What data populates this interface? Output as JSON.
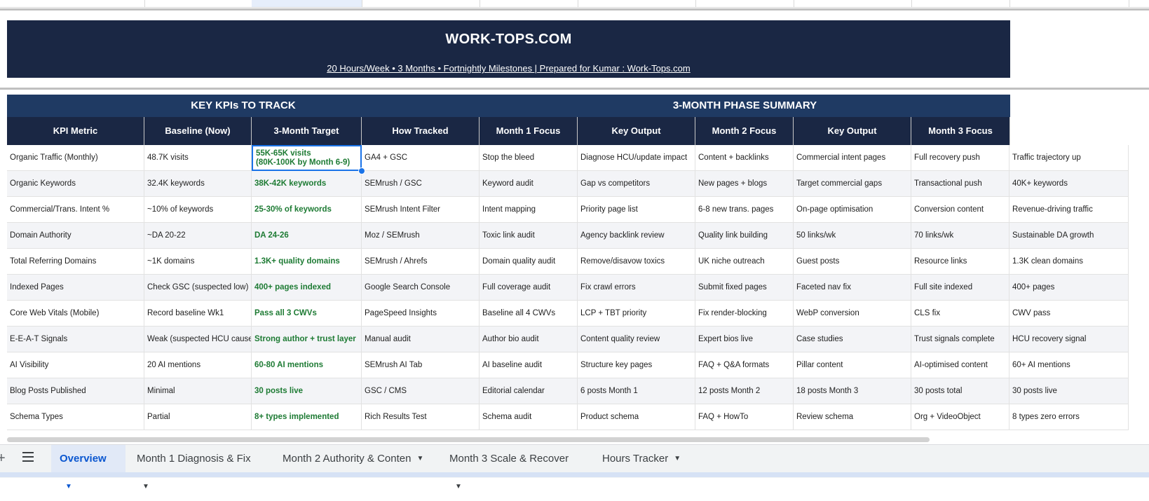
{
  "banner": {
    "title": "WORK-TOPS.COM",
    "subtitle": "20 Hours/Week  •  3 Months  •  Fortnightly Milestones  |  Prepared for Kumar : Work-Tops.com"
  },
  "sections": {
    "kpis": "KEY KPIs TO TRACK",
    "phase": "3-MONTH PHASE SUMMARY"
  },
  "headers": [
    "KPI Metric",
    "Baseline (Now)",
    "3-Month Target",
    "How Tracked",
    "Month 1 Focus",
    "Key Output",
    "Month 2 Focus",
    "Key Output",
    "Month 3 Focus"
  ],
  "rows": [
    {
      "cells": [
        "Organic Traffic (Monthly)",
        "48.7K visits",
        "55K-65K visits\n(80K-100K by Month 6-9)",
        "GA4 + GSC",
        "Stop the bleed",
        "Diagnose HCU/update impact",
        "Content + backlinks",
        "Commercial intent pages",
        "Full recovery push",
        "Traffic trajectory up"
      ]
    },
    {
      "cells": [
        "Organic Keywords",
        "32.4K keywords",
        "38K-42K keywords",
        "SEMrush / GSC",
        "Keyword audit",
        "Gap vs competitors",
        "New pages + blogs",
        "Target commercial gaps",
        "Transactional push",
        "40K+ keywords"
      ]
    },
    {
      "cells": [
        "Commercial/Trans. Intent %",
        "~10% of keywords",
        "25-30% of keywords",
        "SEMrush Intent Filter",
        "Intent mapping",
        "Priority page list",
        "6-8 new trans. pages",
        "On-page optimisation",
        "Conversion content",
        "Revenue-driving traffic"
      ]
    },
    {
      "cells": [
        "Domain Authority",
        "~DA 20-22",
        "DA 24-26",
        "Moz / SEMrush",
        "Toxic link audit",
        "Agency backlink review",
        "Quality link building",
        "50 links/wk",
        "70 links/wk",
        "Sustainable DA growth"
      ]
    },
    {
      "cells": [
        "Total Referring Domains",
        "~1K domains",
        "1.3K+ quality domains",
        "SEMrush / Ahrefs",
        "Domain quality audit",
        "Remove/disavow toxics",
        "UK niche outreach",
        "Guest posts",
        "Resource links",
        "1.3K clean domains"
      ]
    },
    {
      "cells": [
        "Indexed Pages",
        "Check GSC (suspected low)",
        "400+ pages indexed",
        "Google Search Console",
        "Full coverage audit",
        "Fix crawl errors",
        "Submit fixed pages",
        "Faceted nav fix",
        "Full site indexed",
        "400+ pages"
      ]
    },
    {
      "cells": [
        "Core Web Vitals (Mobile)",
        "Record baseline Wk1",
        "Pass all 3 CWVs",
        "PageSpeed Insights",
        "Baseline all 4 CWVs",
        "LCP + TBT priority",
        "Fix render-blocking",
        "WebP conversion",
        "CLS fix",
        "CWV pass"
      ]
    },
    {
      "cells": [
        "E-E-A-T Signals",
        "Weak (suspected HCU cause)",
        "Strong author + trust layer",
        "Manual audit",
        "Author bio audit",
        "Content quality review",
        "Expert bios live",
        "Case studies",
        "Trust signals complete",
        "HCU recovery signal"
      ]
    },
    {
      "cells": [
        "AI Visibility",
        "20 AI mentions",
        "60-80 AI mentions",
        "SEMrush AI Tab",
        "AI baseline audit",
        "Structure key pages",
        "FAQ + Q&A formats",
        "Pillar content",
        "AI-optimised content",
        "60+ AI mentions"
      ]
    },
    {
      "cells": [
        "Blog Posts Published",
        "Minimal",
        "30 posts live",
        "GSC / CMS",
        "Editorial calendar",
        "6 posts Month 1",
        "12 posts Month 2",
        "18 posts Month 3",
        "30 posts total",
        "30 posts live"
      ]
    },
    {
      "cells": [
        "Schema Types",
        "Partial",
        "8+ types implemented",
        "Rich Results Test",
        "Schema audit",
        "Product schema",
        "FAQ + HowTo",
        "Review schema",
        "Org + VideoObject",
        "8 types zero errors"
      ]
    }
  ],
  "tabs": [
    {
      "label": "Overview",
      "active": true
    },
    {
      "label": "Month 1 Diagnosis & Fix",
      "active": false
    },
    {
      "label": "Month 2 Authority & Conten",
      "active": false
    },
    {
      "label": "Month 3 Scale & Recover",
      "active": false
    },
    {
      "label": "Hours Tracker",
      "active": false
    }
  ],
  "icons": {
    "add_sheet": "plus-icon",
    "all_sheets": "hamburger-menu-icon",
    "tab_caret": "caret-down-icon"
  },
  "colors": {
    "banner_bg": "#1a2744",
    "section_bg": "#1f3a63",
    "target_text": "#1e7b34",
    "selection": "#1a73e8",
    "active_tab": "#0b57d0"
  }
}
